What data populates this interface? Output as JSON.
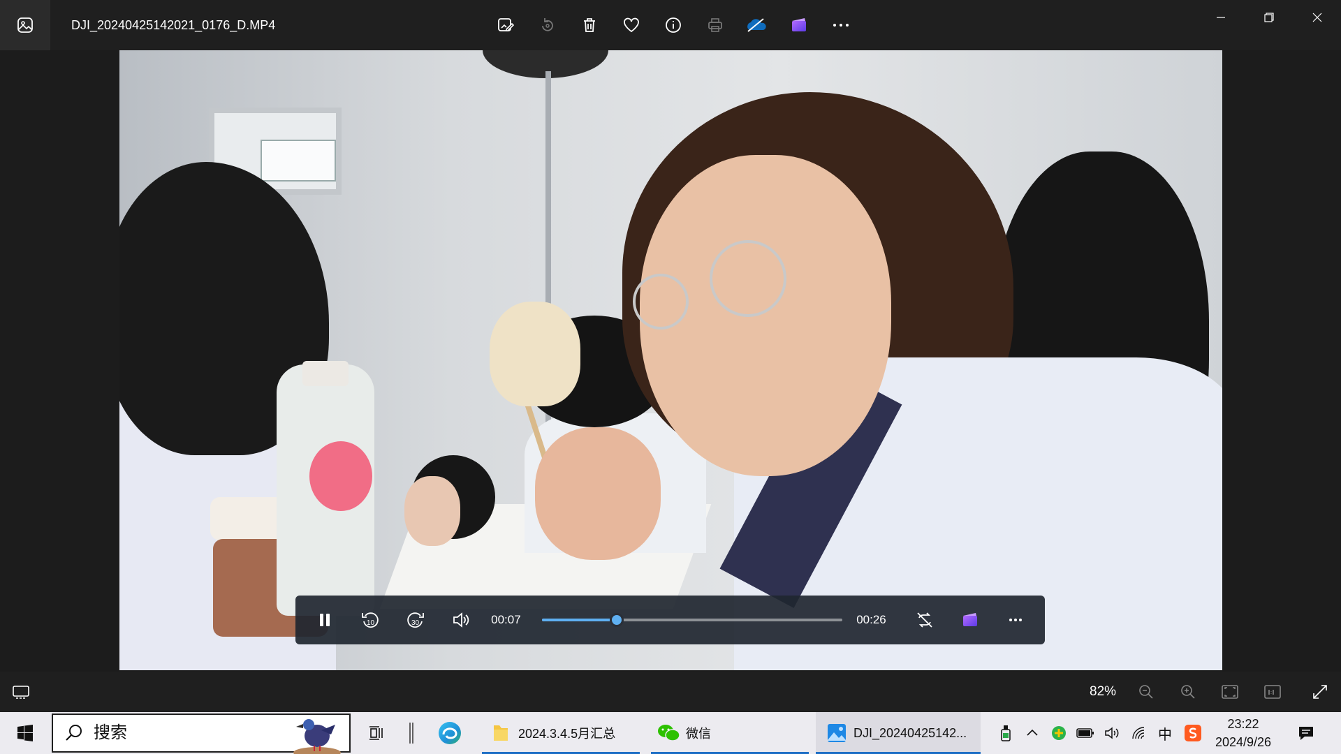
{
  "window": {
    "title": "DJI_20240425142021_0176_D.MP4"
  },
  "toolbar": {
    "icons": [
      "edit-image-icon",
      "rotate-icon",
      "delete-icon",
      "favorite-icon",
      "info-icon",
      "print-icon",
      "onedrive-icon",
      "clipchamp-icon",
      "more-icon"
    ]
  },
  "player": {
    "current_time": "00:07",
    "total_time": "00:26",
    "progress": 0.25
  },
  "statusbar": {
    "zoom": "82%"
  },
  "taskbar": {
    "search_placeholder": "搜索",
    "apps": [
      {
        "label": "2024.3.4.5月汇总"
      },
      {
        "label": "微信"
      },
      {
        "label": "DJI_20240425142..."
      }
    ],
    "clock_time": "23:22",
    "clock_date": "2024/9/26",
    "ime": "中"
  },
  "colors": {
    "accent": "#5fb0f2",
    "taskbar_underline": "#1f6fc5"
  }
}
